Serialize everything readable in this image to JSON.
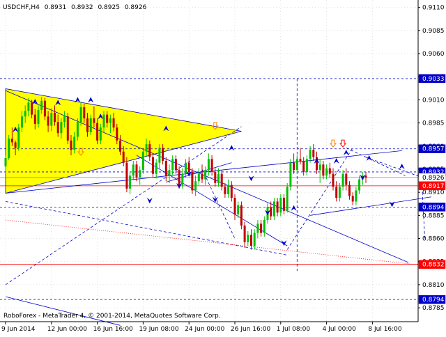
{
  "header": {
    "symbol": "USDCHF,H4",
    "open": "0.8931",
    "high": "0.8932",
    "low": "0.8925",
    "close": "0.8926"
  },
  "footer": {
    "copyright": "RoboForex - MetaTrader 4, © 2001-2014, MetaQuotes Software Corp."
  },
  "colors": {
    "background": "#ffffff",
    "grid": "#c8c8c8",
    "axis": "#000000",
    "bull_candle": "#00c000",
    "bear_candle": "#c00000",
    "trend_lines": "#0000cc",
    "triangle_fill": "#ffff00",
    "red_levels": "#ff0000",
    "price_badge_blue": "#0000cc",
    "price_badge_red": "#ff0000"
  },
  "icons": {
    "projection_arrows": "chevron-arrow-icon",
    "signal_arrows": "down-arrow-icon"
  },
  "chart_data": {
    "type": "candlestick",
    "title": "USDCHF,H4 0.8931 0.8932 0.8925 0.8926",
    "xlabel": "",
    "ylabel": "",
    "ylim": [
      0.877,
      0.9118
    ],
    "y_ticks": [
      "0.9110",
      "0.9085",
      "0.9060",
      "0.9035",
      "0.9010",
      "0.8985",
      "0.8960",
      "0.8935",
      "0.8910",
      "0.8885",
      "0.8860",
      "0.8835",
      "0.8810",
      "0.8785"
    ],
    "x_ticks": [
      "9 Jun 2014",
      "12 Jun 00:00",
      "16 Jun 16:00",
      "19 Jun 08:00",
      "24 Jun 00:00",
      "26 Jun 16:00",
      "1 Jul 08:00",
      "4 Jul 00:00",
      "8 Jul 16:00"
    ],
    "x_tick_index": [
      0,
      14,
      28,
      42,
      56,
      70,
      84,
      98,
      112
    ],
    "grid": true,
    "legend": "none",
    "levels": [
      {
        "label": "0.9033",
        "value": 0.9033,
        "color": "blue",
        "style": "dashed"
      },
      {
        "label": "0.8957",
        "value": 0.8957,
        "color": "blue",
        "style": "dashed"
      },
      {
        "label": "0.8932",
        "value": 0.8932,
        "color": "blue",
        "style": "dashed"
      },
      {
        "label": "0.8926",
        "value": 0.8926,
        "color": "gray",
        "style": "solid"
      },
      {
        "label": "0.8917",
        "value": 0.8917,
        "color": "red",
        "style": "solid"
      },
      {
        "label": "0.8894",
        "value": 0.8894,
        "color": "blue",
        "style": "dashed"
      },
      {
        "label": "0.8832",
        "value": 0.8832,
        "color": "red",
        "style": "solid"
      },
      {
        "label": "0.8794",
        "value": 0.8794,
        "color": "blue",
        "style": "dashed"
      }
    ],
    "triangle": {
      "points": [
        [
          0,
          0.9022
        ],
        [
          0,
          0.8909
        ],
        [
          72,
          0.8976
        ]
      ]
    },
    "lines": [
      {
        "style": "solid",
        "from": [
          0,
          0.902
        ],
        "to": [
          123,
          0.8834
        ]
      },
      {
        "style": "solid",
        "from": [
          0,
          0.8909
        ],
        "to": [
          121,
          0.8955
        ]
      },
      {
        "style": "solid",
        "from": [
          93,
          0.8885
        ],
        "to": [
          130,
          0.8905
        ]
      },
      {
        "style": "solid",
        "from": [
          0,
          0.8797
        ],
        "to": [
          35,
          0.8766
        ]
      },
      {
        "style": "solid",
        "from": [
          40,
          0.895
        ],
        "to": [
          86,
          0.8852
        ]
      },
      {
        "style": "solid",
        "from": [
          49,
          0.8921
        ],
        "to": [
          69,
          0.8942
        ]
      },
      {
        "style": "dashed",
        "from": [
          0,
          0.89
        ],
        "to": [
          86,
          0.8842
        ]
      },
      {
        "style": "dashed",
        "from": [
          0,
          0.881
        ],
        "to": [
          72,
          0.8981
        ]
      },
      {
        "style": "dashed",
        "from": [
          86,
          0.8848
        ],
        "to": [
          106,
          0.8958
        ]
      },
      {
        "style": "dashed",
        "from": [
          60,
          0.8935
        ],
        "to": [
          70,
          0.886
        ]
      },
      {
        "style": "dashed",
        "from": [
          104,
          0.8958
        ],
        "to": [
          122,
          0.8928
        ]
      },
      {
        "style": "dashed",
        "from": [
          110,
          0.8948
        ],
        "to": [
          128,
          0.8925
        ]
      },
      {
        "style": "dashed",
        "from": [
          127,
          0.8926
        ],
        "to": [
          128,
          0.886
        ]
      },
      {
        "style": "dashed",
        "from": [
          89,
          0.9033
        ],
        "to": [
          89,
          0.8825
        ]
      },
      {
        "style": "dotted",
        "from": [
          0,
          0.888
        ],
        "to": [
          130,
          0.883
        ]
      }
    ],
    "projection_arrows": [
      {
        "x": 3,
        "value": 0.8978,
        "dir": "up"
      },
      {
        "x": 9,
        "value": 0.9008,
        "dir": "up"
      },
      {
        "x": 16,
        "value": 0.9007,
        "dir": "up"
      },
      {
        "x": 22,
        "value": 0.901,
        "dir": "up"
      },
      {
        "x": 26,
        "value": 0.901,
        "dir": "up"
      },
      {
        "x": 29,
        "value": 0.8992,
        "dir": "up"
      },
      {
        "x": 44,
        "value": 0.8901,
        "dir": "down"
      },
      {
        "x": 49,
        "value": 0.8979,
        "dir": "up"
      },
      {
        "x": 53,
        "value": 0.8917,
        "dir": "down"
      },
      {
        "x": 56,
        "value": 0.893,
        "dir": "down"
      },
      {
        "x": 64,
        "value": 0.8902,
        "dir": "down"
      },
      {
        "x": 69,
        "value": 0.8958,
        "dir": "up"
      },
      {
        "x": 75,
        "value": 0.8925,
        "dir": "down"
      },
      {
        "x": 80,
        "value": 0.8888,
        "dir": "down"
      },
      {
        "x": 85,
        "value": 0.8855,
        "dir": "down"
      },
      {
        "x": 88,
        "value": 0.8893,
        "dir": "up"
      },
      {
        "x": 95,
        "value": 0.8944,
        "dir": "up"
      },
      {
        "x": 101,
        "value": 0.8944,
        "dir": "up"
      },
      {
        "x": 104,
        "value": 0.8953,
        "dir": "up"
      },
      {
        "x": 109,
        "value": 0.8926,
        "dir": "down"
      },
      {
        "x": 111,
        "value": 0.8947,
        "dir": "up"
      },
      {
        "x": 118,
        "value": 0.8897,
        "dir": "down"
      },
      {
        "x": 121,
        "value": 0.8938,
        "dir": "up"
      }
    ],
    "signal_arrows": [
      {
        "x": 23,
        "value": 0.8953,
        "color": "orange"
      },
      {
        "x": 64,
        "value": 0.8981,
        "color": "orange"
      },
      {
        "x": 100,
        "value": 0.8962,
        "color": "orange"
      },
      {
        "x": 103,
        "value": 0.8962,
        "color": "red"
      }
    ],
    "candles": [
      [
        0.8938,
        0.895,
        0.893,
        0.8947
      ],
      [
        0.8947,
        0.8972,
        0.8945,
        0.8968
      ],
      [
        0.8968,
        0.898,
        0.896,
        0.8964
      ],
      [
        0.8964,
        0.8966,
        0.895,
        0.8958
      ],
      [
        0.8958,
        0.8984,
        0.8955,
        0.898
      ],
      [
        0.898,
        0.8998,
        0.8975,
        0.8992
      ],
      [
        0.8992,
        0.9004,
        0.8985,
        0.8998
      ],
      [
        0.8998,
        0.9012,
        0.8992,
        0.9007
      ],
      [
        0.9007,
        0.901,
        0.899,
        0.8994
      ],
      [
        0.8994,
        0.9,
        0.8978,
        0.8984
      ],
      [
        0.8984,
        0.9004,
        0.898,
        0.8999
      ],
      [
        0.8999,
        0.9013,
        0.8995,
        0.9009
      ],
      [
        0.9009,
        0.9012,
        0.8988,
        0.8992
      ],
      [
        0.8992,
        0.8998,
        0.8975,
        0.8982
      ],
      [
        0.8982,
        0.9001,
        0.8976,
        0.8996
      ],
      [
        0.8996,
        0.9004,
        0.8982,
        0.8986
      ],
      [
        0.8986,
        0.8994,
        0.897,
        0.8974
      ],
      [
        0.8974,
        0.899,
        0.8968,
        0.8986
      ],
      [
        0.8986,
        0.8998,
        0.898,
        0.8992
      ],
      [
        0.8992,
        0.8996,
        0.8962,
        0.8966
      ],
      [
        0.8966,
        0.8972,
        0.895,
        0.8956
      ],
      [
        0.8956,
        0.8975,
        0.8952,
        0.897
      ],
      [
        0.897,
        0.899,
        0.8966,
        0.8986
      ],
      [
        0.8986,
        0.9008,
        0.8982,
        0.9002
      ],
      [
        0.9002,
        0.9006,
        0.8985,
        0.899
      ],
      [
        0.899,
        0.8996,
        0.897,
        0.8975
      ],
      [
        0.8975,
        0.8994,
        0.8972,
        0.899
      ],
      [
        0.899,
        0.9003,
        0.898,
        0.8985
      ],
      [
        0.8985,
        0.899,
        0.8962,
        0.8966
      ],
      [
        0.8966,
        0.8984,
        0.8962,
        0.898
      ],
      [
        0.898,
        0.8998,
        0.8975,
        0.8994
      ],
      [
        0.8994,
        0.8998,
        0.898,
        0.8985
      ],
      [
        0.8985,
        0.8994,
        0.8974,
        0.899
      ],
      [
        0.899,
        0.8996,
        0.8976,
        0.898
      ],
      [
        0.898,
        0.8984,
        0.8962,
        0.8966
      ],
      [
        0.8966,
        0.8972,
        0.895,
        0.8954
      ],
      [
        0.8954,
        0.896,
        0.8938,
        0.8942
      ],
      [
        0.8942,
        0.8948,
        0.891,
        0.8914
      ],
      [
        0.8914,
        0.8932,
        0.8908,
        0.8928
      ],
      [
        0.8928,
        0.8944,
        0.8924,
        0.894
      ],
      [
        0.894,
        0.8944,
        0.8922,
        0.8926
      ],
      [
        0.8926,
        0.8938,
        0.8918,
        0.8934
      ],
      [
        0.8934,
        0.8958,
        0.893,
        0.8954
      ],
      [
        0.8954,
        0.8968,
        0.8948,
        0.8962
      ],
      [
        0.8962,
        0.8966,
        0.8944,
        0.8948
      ],
      [
        0.8948,
        0.8952,
        0.8926,
        0.893
      ],
      [
        0.893,
        0.8946,
        0.8925,
        0.8942
      ],
      [
        0.8942,
        0.8962,
        0.8936,
        0.8958
      ],
      [
        0.8958,
        0.8962,
        0.894,
        0.8944
      ],
      [
        0.8944,
        0.8948,
        0.8922,
        0.8928
      ],
      [
        0.8928,
        0.894,
        0.892,
        0.8934
      ],
      [
        0.8934,
        0.895,
        0.8928,
        0.8946
      ],
      [
        0.8946,
        0.895,
        0.893,
        0.8934
      ],
      [
        0.8934,
        0.8938,
        0.8914,
        0.8918
      ],
      [
        0.8918,
        0.8936,
        0.8914,
        0.893
      ],
      [
        0.893,
        0.8946,
        0.8926,
        0.8942
      ],
      [
        0.8942,
        0.8948,
        0.8928,
        0.8932
      ],
      [
        0.8932,
        0.8936,
        0.8908,
        0.8912
      ],
      [
        0.8912,
        0.8928,
        0.8906,
        0.8922
      ],
      [
        0.8922,
        0.8936,
        0.8918,
        0.893
      ],
      [
        0.893,
        0.894,
        0.892,
        0.8924
      ],
      [
        0.8924,
        0.8938,
        0.8918,
        0.8934
      ],
      [
        0.8934,
        0.8952,
        0.8928,
        0.8946
      ],
      [
        0.8946,
        0.895,
        0.8928,
        0.8932
      ],
      [
        0.8932,
        0.8936,
        0.8916,
        0.892
      ],
      [
        0.892,
        0.8936,
        0.8916,
        0.893
      ],
      [
        0.893,
        0.8934,
        0.8912,
        0.8916
      ],
      [
        0.8916,
        0.892,
        0.8904,
        0.8908
      ],
      [
        0.8908,
        0.8924,
        0.8904,
        0.8918
      ],
      [
        0.8918,
        0.8922,
        0.89,
        0.8904
      ],
      [
        0.8904,
        0.8908,
        0.888,
        0.8886
      ],
      [
        0.8886,
        0.89,
        0.8882,
        0.8896
      ],
      [
        0.8896,
        0.89,
        0.887,
        0.8874
      ],
      [
        0.8874,
        0.8878,
        0.885,
        0.8856
      ],
      [
        0.8856,
        0.8868,
        0.8852,
        0.8864
      ],
      [
        0.8864,
        0.887,
        0.8848,
        0.8852
      ],
      [
        0.8852,
        0.887,
        0.8848,
        0.8866
      ],
      [
        0.8866,
        0.888,
        0.886,
        0.8876
      ],
      [
        0.8876,
        0.888,
        0.8862,
        0.8866
      ],
      [
        0.8866,
        0.8884,
        0.8862,
        0.888
      ],
      [
        0.888,
        0.8898,
        0.8876,
        0.8894
      ],
      [
        0.8894,
        0.89,
        0.888,
        0.8884
      ],
      [
        0.8884,
        0.8904,
        0.888,
        0.89
      ],
      [
        0.89,
        0.8904,
        0.8884,
        0.8888
      ],
      [
        0.8888,
        0.8908,
        0.8884,
        0.8904
      ],
      [
        0.8904,
        0.8908,
        0.8886,
        0.889
      ],
      [
        0.889,
        0.892,
        0.8888,
        0.8916
      ],
      [
        0.8916,
        0.8946,
        0.8912,
        0.8942
      ],
      [
        0.8942,
        0.8952,
        0.893,
        0.8934
      ],
      [
        0.8934,
        0.895,
        0.893,
        0.8946
      ],
      [
        0.8946,
        0.8958,
        0.894,
        0.8944
      ],
      [
        0.8944,
        0.8948,
        0.8928,
        0.8932
      ],
      [
        0.8932,
        0.895,
        0.8928,
        0.8946
      ],
      [
        0.8946,
        0.896,
        0.8942,
        0.8956
      ],
      [
        0.8956,
        0.8962,
        0.8944,
        0.8948
      ],
      [
        0.8948,
        0.8954,
        0.893,
        0.8934
      ],
      [
        0.8934,
        0.8946,
        0.892,
        0.894
      ],
      [
        0.894,
        0.8944,
        0.8924,
        0.8928
      ],
      [
        0.8928,
        0.894,
        0.8924,
        0.8936
      ],
      [
        0.8936,
        0.8942,
        0.8926,
        0.893
      ],
      [
        0.893,
        0.8936,
        0.8912,
        0.8916
      ],
      [
        0.8916,
        0.8922,
        0.89,
        0.8904
      ],
      [
        0.8904,
        0.892,
        0.89,
        0.8916
      ],
      [
        0.8916,
        0.8934,
        0.8912,
        0.893
      ],
      [
        0.893,
        0.8936,
        0.8912,
        0.8918
      ],
      [
        0.8918,
        0.8922,
        0.8902,
        0.8906
      ],
      [
        0.8906,
        0.891,
        0.8896,
        0.89
      ],
      [
        0.89,
        0.8916,
        0.8896,
        0.8912
      ],
      [
        0.8912,
        0.8928,
        0.8908,
        0.8924
      ],
      [
        0.8924,
        0.8932,
        0.8918,
        0.8928
      ],
      [
        0.8928,
        0.8932,
        0.892,
        0.8926
      ]
    ]
  }
}
